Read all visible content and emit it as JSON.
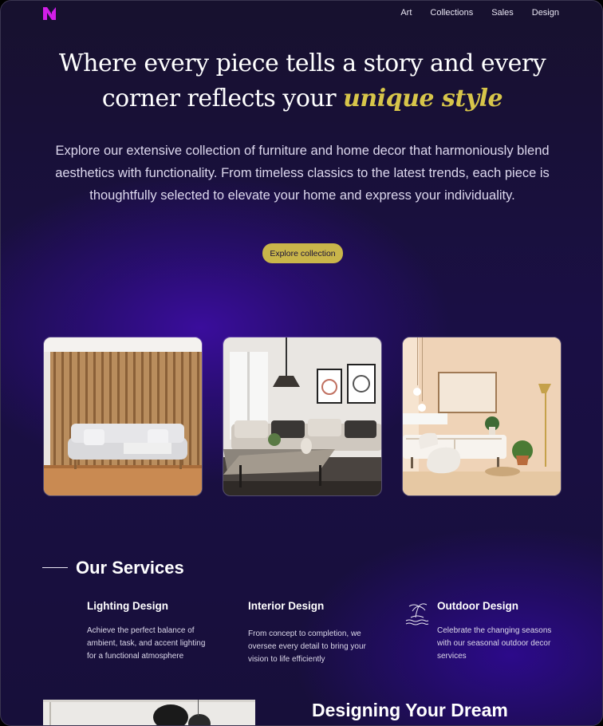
{
  "nav": {
    "items": [
      "Art",
      "Collections",
      "Sales",
      "Design"
    ]
  },
  "hero": {
    "headline_line1": "Where every piece tells a story and every",
    "headline_line2": "corner reflects your",
    "headline_accent": "unique style",
    "intro": "Explore our extensive collection of furniture and home decor that harmoniously blend aesthetics with functionality. From timeless classics to the latest trends, each piece is thoughtfully selected to elevate your home and express your individuality.",
    "cta_label": "Explore collection"
  },
  "gallery": {
    "images": [
      "living-room-slatted-wall-photo",
      "living-room-pendant-lamp-photo",
      "living-room-beige-photo"
    ]
  },
  "services": {
    "title": "Our Services",
    "items": [
      {
        "title": "Lighting Design",
        "description": "Achieve the perfect balance of ambient, task, and accent lighting for a functional atmosphere"
      },
      {
        "title": "Interior Design",
        "description": "From concept to completion, we oversee every detail to bring your vision to life efficiently"
      },
      {
        "title": "Outdoor Design",
        "description": "Celebrate the changing seasons with our seasonal outdoor decor services",
        "icon": "palm-island-icon"
      }
    ]
  },
  "dream": {
    "title": "Designing Your Dream"
  },
  "colors": {
    "accent": "#d7c54a",
    "cta": "#c9b54a",
    "brand": "#d21ee8",
    "background": "#1a0f45"
  }
}
